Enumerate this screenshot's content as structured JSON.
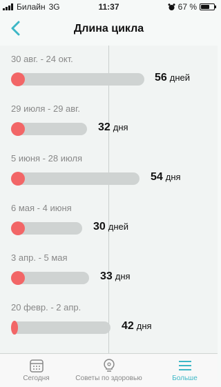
{
  "status_bar": {
    "carrier": "Билайн",
    "network": "3G",
    "time": "11:37",
    "battery": "67 %",
    "battery_level": 0.67,
    "icons": [
      "signal-bars-icon",
      "alarm-icon",
      "battery-icon"
    ]
  },
  "header": {
    "title": "Длина цикла",
    "back_icon": "chevron-left-icon"
  },
  "cycles": [
    {
      "range": "30 авг. - 24 окт.",
      "days": "56",
      "unit": "дней",
      "value": 56
    },
    {
      "range": "29 июля - 29 авг.",
      "days": "32",
      "unit": "дня",
      "value": 32
    },
    {
      "range": "5 июня - 28 июля",
      "days": "54",
      "unit": "дня",
      "value": 54
    },
    {
      "range": "6 мая - 4 июня",
      "days": "30",
      "unit": "дней",
      "value": 30
    },
    {
      "range": "3 апр. - 5 мая",
      "days": "33",
      "unit": "дня",
      "value": 33
    },
    {
      "range": "20 февр. - 2 апр.",
      "days": "42",
      "unit": "дня",
      "value": 42
    }
  ],
  "tabs": [
    {
      "label": "Сегодня",
      "icon": "calendar-icon",
      "active": false
    },
    {
      "label": "Советы по здоровью",
      "icon": "lightbulb-icon",
      "active": false
    },
    {
      "label": "Больше",
      "icon": "menu-icon",
      "active": true
    }
  ],
  "colors": {
    "accent": "#3db7c6",
    "marker": "#f26667",
    "track": "#cfd3d2"
  }
}
